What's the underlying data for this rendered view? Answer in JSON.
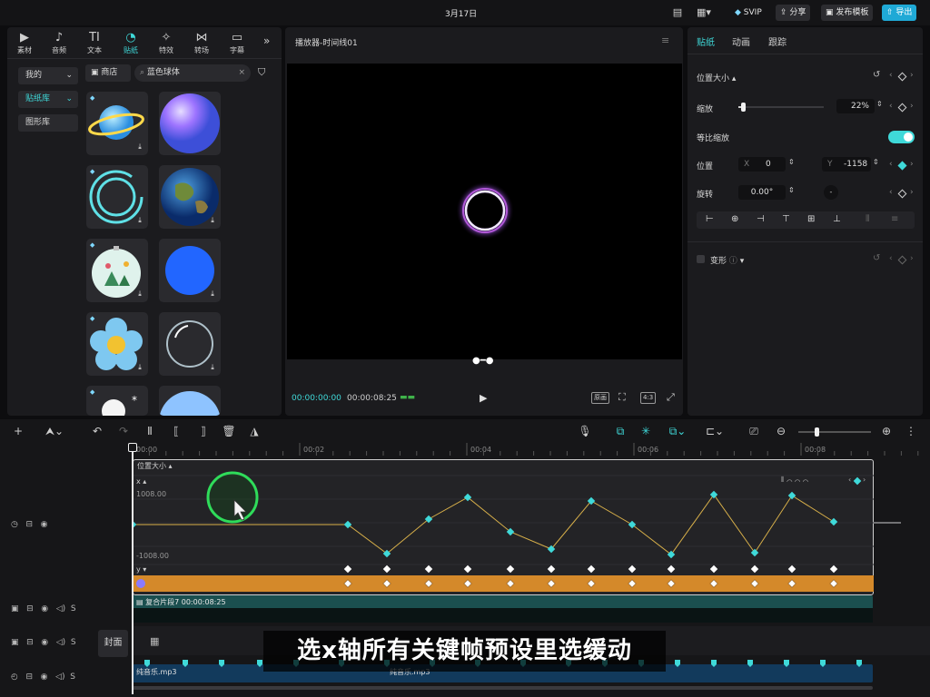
{
  "topbar": {
    "date": "3月17日",
    "svip": "SVIP",
    "share": "分享",
    "publish_template": "发布模板",
    "export": "导出"
  },
  "media_tabs": [
    {
      "label": "素材",
      "icon": "media-icon",
      "glyph": "▶",
      "active": false
    },
    {
      "label": "音频",
      "icon": "audio-icon",
      "glyph": "♪",
      "active": false
    },
    {
      "label": "文本",
      "icon": "text-icon",
      "glyph": "TI",
      "active": false
    },
    {
      "label": "贴纸",
      "icon": "sticker-icon",
      "glyph": "◔",
      "active": true
    },
    {
      "label": "特效",
      "icon": "effects-icon",
      "glyph": "✧",
      "active": false
    },
    {
      "label": "转场",
      "icon": "transition-icon",
      "glyph": "⋈",
      "active": false
    },
    {
      "label": "字幕",
      "icon": "caption-icon",
      "glyph": "▭",
      "active": false
    }
  ],
  "sidebar": {
    "items": [
      {
        "label": "我的",
        "active": false
      },
      {
        "label": "贴纸库",
        "active": true
      },
      {
        "label": "图形库",
        "active": false
      }
    ]
  },
  "sticker_search": {
    "store": "商店",
    "query": "蓝色球体"
  },
  "player": {
    "title": "播放器-时间线01",
    "current_time": "00:00:00:00",
    "total_time": "00:00:08:25",
    "quality_btn": "原画",
    "ratio_btn": "4:3"
  },
  "right_panel": {
    "tabs": [
      {
        "label": "贴纸",
        "active": true
      },
      {
        "label": "动画",
        "active": false
      },
      {
        "label": "跟踪",
        "active": false
      }
    ],
    "section": "位置大小",
    "scale_label": "缩放",
    "scale_value": "22%",
    "scale_fraction": 0.05,
    "uniform_scale_label": "等比缩放",
    "uniform_scale_on": true,
    "position_label": "位置",
    "pos_x_label": "X",
    "pos_x": "0",
    "pos_y_label": "Y",
    "pos_y": "-1158",
    "rotation_label": "旋转",
    "rotation": "0.00°",
    "transform_label": "变形"
  },
  "timeline": {
    "ruler": [
      "00:00",
      "00:02",
      "00:04",
      "00:06",
      "00:08"
    ],
    "graph_section": "位置大小",
    "graph_axis": "x",
    "graph_max": "1008.00",
    "graph_min": "-1008.00",
    "graph_y_axis": "y",
    "compound_clip": "复合片段7",
    "compound_duration": "00:00:08:25",
    "cover_label": "封面",
    "audio_left": "纯音乐.mp3",
    "audio_right": "纯音乐.mp3"
  },
  "subtitle": "选x轴所有关键帧预设里选缓动",
  "colors": {
    "accent": "#3fd9d9",
    "keyframe_track": "#d4892a",
    "compound_track": "#1b4f4f",
    "audio_track": "#123a5c",
    "curve": "#d8b04a"
  }
}
